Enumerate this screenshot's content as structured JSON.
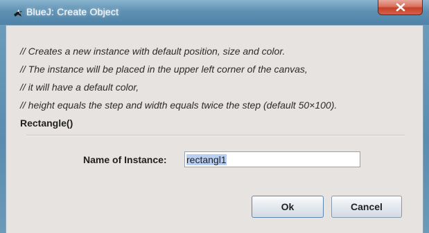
{
  "window": {
    "title": "BlueJ:  Create Object",
    "close_glyph": "X",
    "colors": {
      "titlebar": "#5e90b2",
      "content": "#e7e3e0",
      "close": "#c7402a"
    }
  },
  "dialog": {
    "comment_lines": [
      "// Creates a new instance with default position, size and color.",
      "// The instance will be placed in the upper left corner of the canvas,",
      "// it will have a default color,",
      "// height equals the step and width equals twice the step (default 50×100)."
    ],
    "constructor": "Rectangle()",
    "name_label": "Name of Instance:",
    "name_value": "rectangl1",
    "ok_label": "Ok",
    "cancel_label": "Cancel"
  },
  "icons": {
    "app": "bluej-bird-icon",
    "close": "close-icon"
  }
}
